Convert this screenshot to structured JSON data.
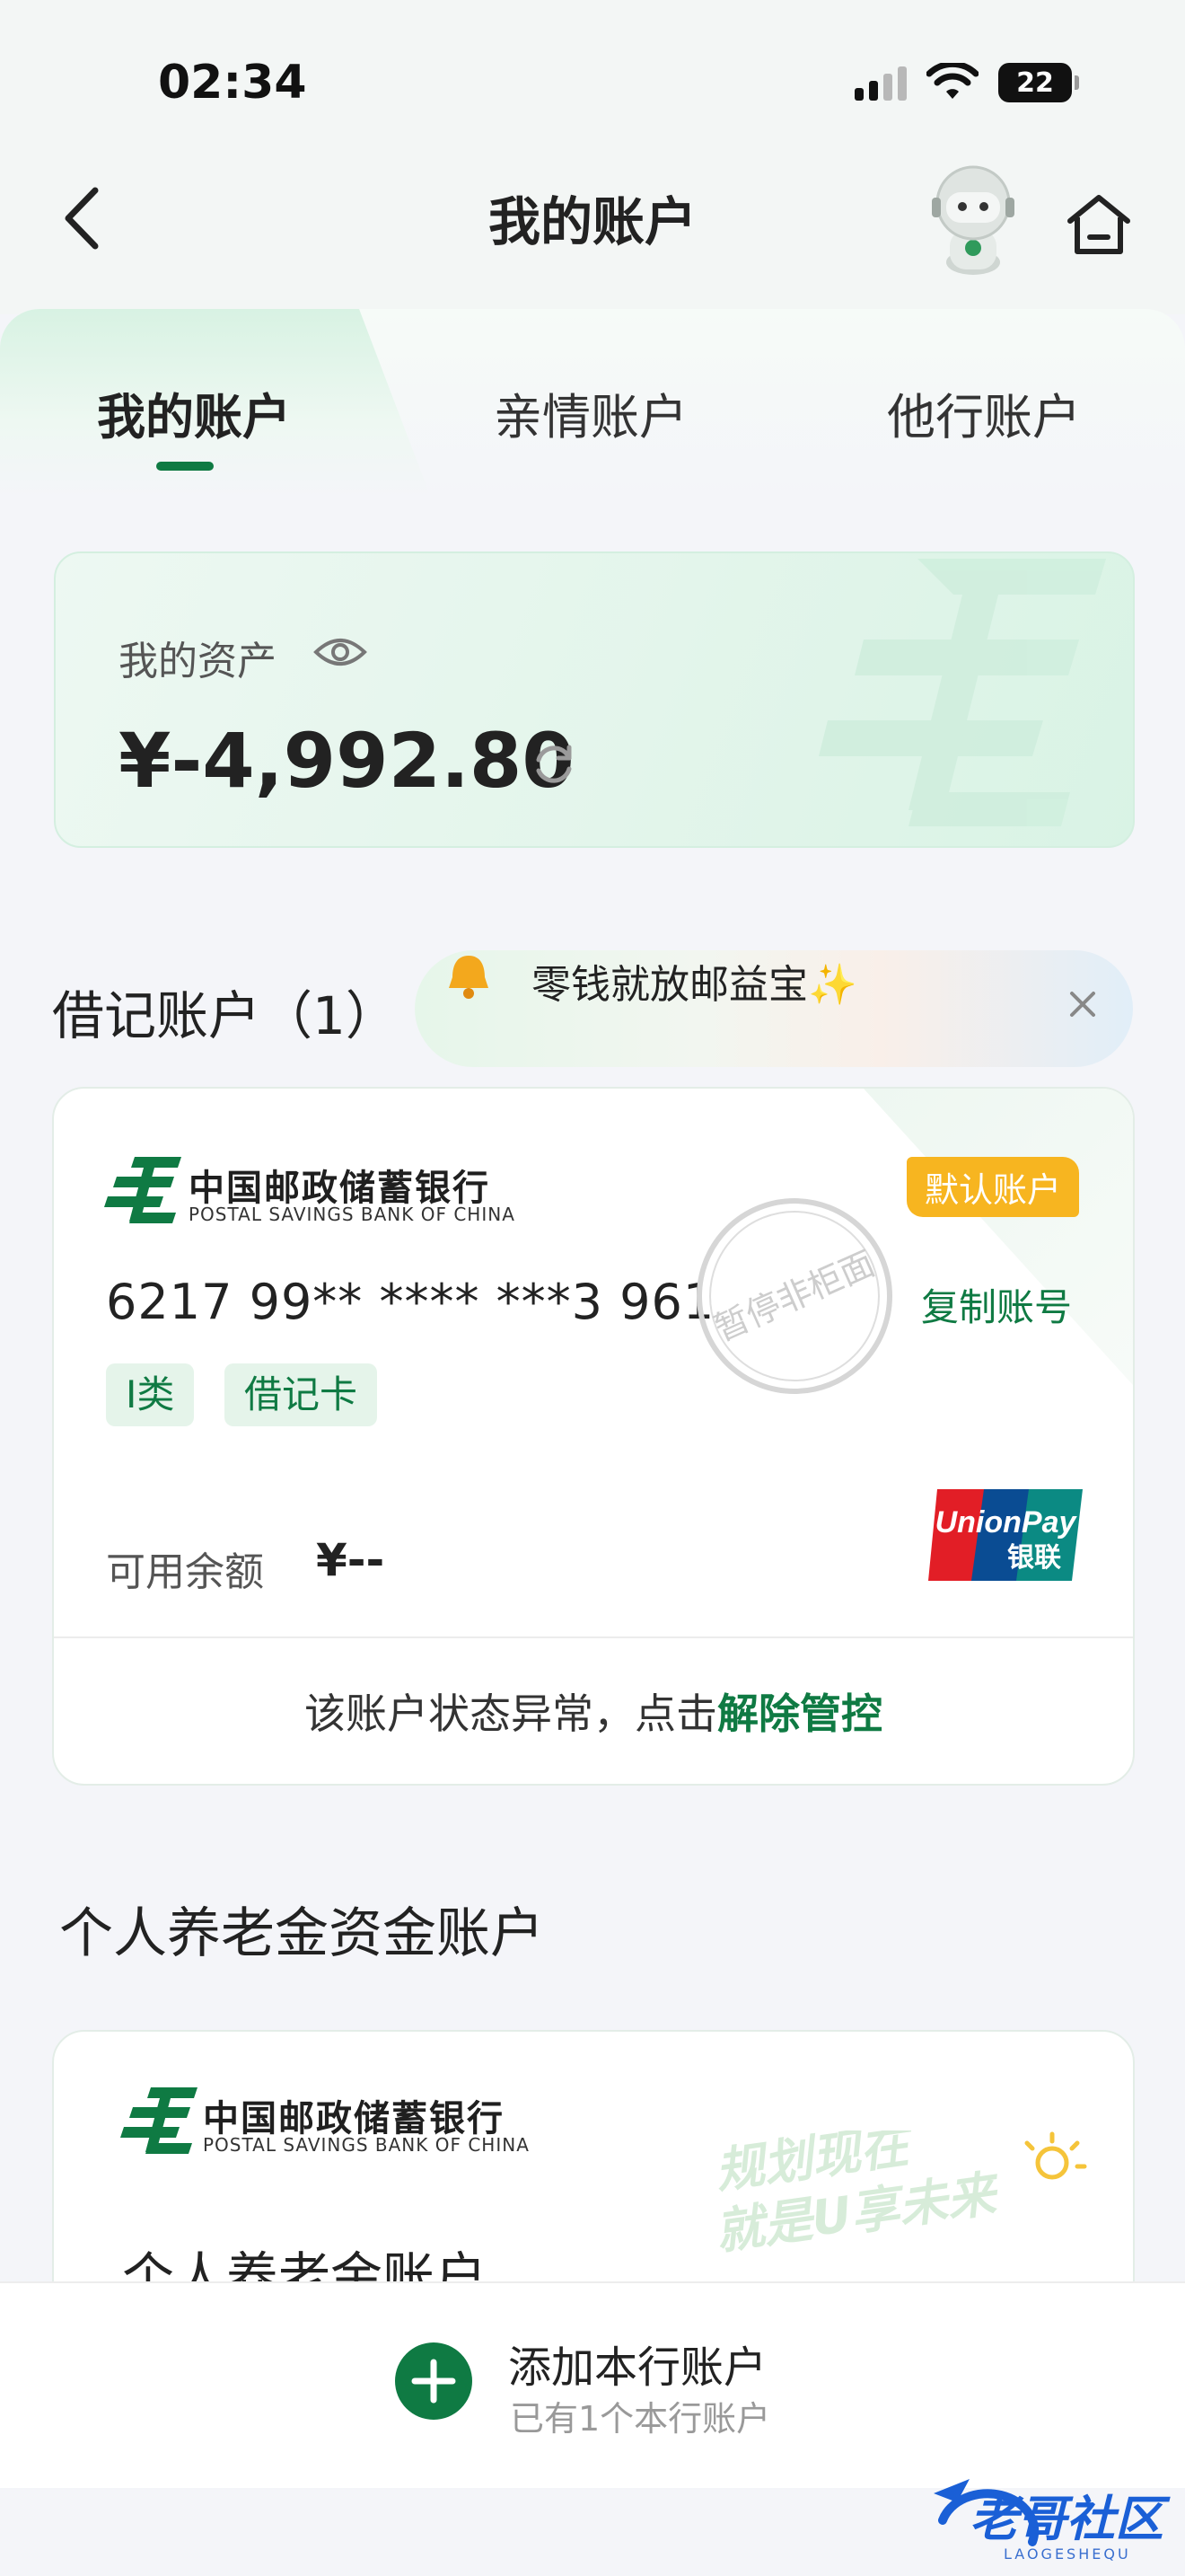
{
  "status_bar": {
    "time": "02:34",
    "battery": "22"
  },
  "header": {
    "title": "我的账户"
  },
  "tabs": [
    {
      "label": "我的账户",
      "active": true
    },
    {
      "label": "亲情账户",
      "active": false
    },
    {
      "label": "他行账户",
      "active": false
    }
  ],
  "assets": {
    "label": "我的资产",
    "amount": "¥-4,992.80"
  },
  "debit_section": {
    "title": "借记账户（1）",
    "promo": "零钱就放邮益宝✨"
  },
  "debit_card": {
    "bank_name_cn": "中国邮政储蓄银行",
    "bank_name_en": "POSTAL SAVINGS BANK OF CHINA",
    "default_badge": "默认账户",
    "card_number": "6217 99** **** ***3 961",
    "stamp_text": "暂停非柜面",
    "copy_label": "复制账号",
    "tags": [
      "Ⅰ类",
      "借记卡"
    ],
    "balance_label": "可用余额",
    "balance_value": "¥--",
    "unionpay_en": "UnionPay",
    "unionpay_cn": "银联",
    "footer_text": "该账户状态异常，点击",
    "footer_link": "解除管控"
  },
  "pension_section": {
    "title": "个人养老金资金账户",
    "bank_name_cn": "中国邮政储蓄银行",
    "bank_name_en": "POSTAL SAVINGS BANK OF CHINA",
    "slogan_line1": "规划现在",
    "slogan_line2": "就是U享未来",
    "account_title": "个人养老金账户"
  },
  "bottom_bar": {
    "add_title": "添加本行账户",
    "add_subtitle": "已有1个本行账户"
  },
  "watermark": {
    "text": "老哥社区",
    "sub": "LAOGESHEQU"
  },
  "colors": {
    "brand_green": "#0f7a43",
    "badge_yellow": "#f7b520",
    "unionpay_red": "#e21e26",
    "unionpay_blue": "#0a4c93",
    "unionpay_teal": "#0b8a83"
  }
}
